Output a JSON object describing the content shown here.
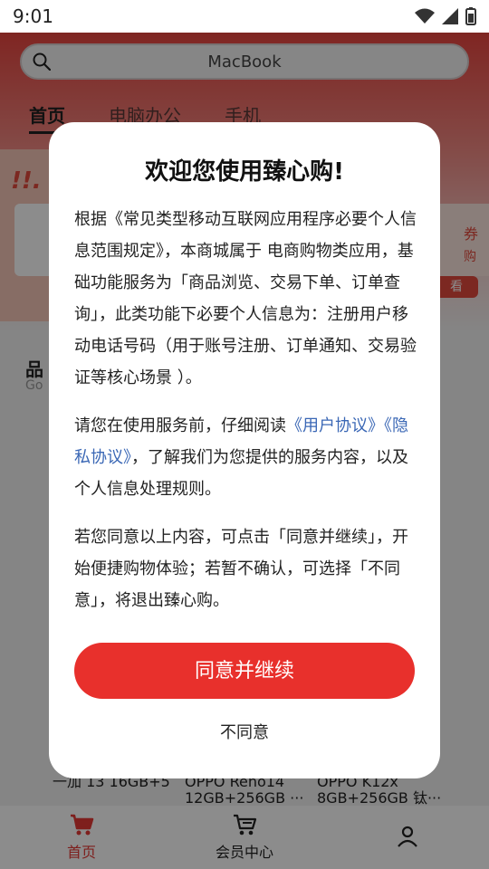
{
  "status_bar": {
    "time": "9:01"
  },
  "search": {
    "placeholder": "MacBook"
  },
  "tabs": [
    {
      "label": "首页"
    },
    {
      "label": "电脑办公"
    },
    {
      "label": "手机"
    }
  ],
  "banner": {
    "deco": "!!.",
    "coupon_text": "券",
    "coupon_sub": "购",
    "coupon_btn": "看"
  },
  "section": {
    "title": "品",
    "subtitle": "Go"
  },
  "products": [
    {
      "name": "一加 13 16GB+5"
    },
    {
      "name": "OPPO Reno14 12GB+256GB ···"
    },
    {
      "name": "OPPO K12x 8GB+256GB 钛···"
    }
  ],
  "bottom_nav": [
    {
      "label": "首页"
    },
    {
      "label": "会员中心"
    },
    {
      "label": ""
    }
  ],
  "dialog": {
    "title": "欢迎您使用臻心购!",
    "para1": "根据《常见类型移动互联网应用程序必要个人信息范围规定》，本商城属于 电商购物类应用，基础功能服务为「商品浏览、交易下单、订单查询」，此类功能下必要个人信息为：注册用户移动电话号码（用于账号注册、订单通知、交易验证等核心场景 ）。",
    "para2_prefix": "请您在使用服务前，仔细阅读",
    "user_agreement": "《用户协议》",
    "privacy_policy": "《隐私协议》",
    "para2_suffix": "，了解我们为您提供的服务内容，以及个人信息处理规则。",
    "para3": "若您同意以上内容，可点击「同意并继续」，开始便捷购物体验；若暂不确认，可选择「不同意」，将退出臻心购。",
    "agree_label": "同意并继续",
    "disagree_label": "不同意"
  },
  "colors": {
    "accent": "#e8302c",
    "link": "#3a67b5"
  }
}
